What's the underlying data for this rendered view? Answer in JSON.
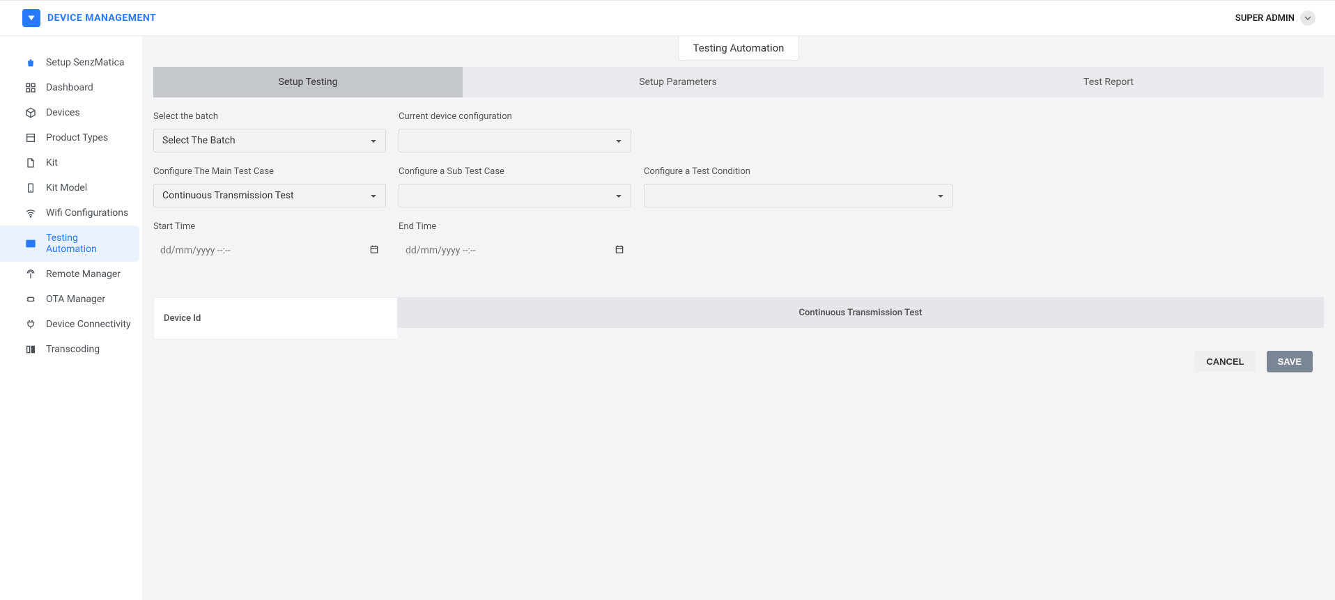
{
  "header": {
    "title": "DEVICE MANAGEMENT",
    "user": "SUPER ADMIN"
  },
  "sidebar": {
    "items": [
      {
        "label": "Setup SenzMatica",
        "icon": "bag-icon"
      },
      {
        "label": "Dashboard",
        "icon": "grid-icon"
      },
      {
        "label": "Devices",
        "icon": "cube-icon"
      },
      {
        "label": "Product Types",
        "icon": "box-icon"
      },
      {
        "label": "Kit",
        "icon": "file-icon"
      },
      {
        "label": "Kit Model",
        "icon": "phone-icon"
      },
      {
        "label": "Wifi Configurations",
        "icon": "wifi-icon"
      },
      {
        "label": "Testing Automation",
        "icon": "terminal-icon",
        "active": true
      },
      {
        "label": "Remote Manager",
        "icon": "antenna-icon"
      },
      {
        "label": "OTA Manager",
        "icon": "chip-icon"
      },
      {
        "label": "Device Connectivity",
        "icon": "plug-icon"
      },
      {
        "label": "Transcoding",
        "icon": "columns-icon"
      }
    ]
  },
  "breadcrumb": "Testing Automation",
  "tabs": [
    {
      "label": "Setup Testing",
      "active": true
    },
    {
      "label": "Setup Parameters"
    },
    {
      "label": "Test Report"
    }
  ],
  "form": {
    "batch": {
      "label": "Select the batch",
      "value": "Select The Batch"
    },
    "device_config": {
      "label": "Current device configuration",
      "value": ""
    },
    "main_test": {
      "label": "Configure The Main Test Case",
      "value": "Continuous Transmission Test"
    },
    "sub_test": {
      "label": "Configure a Sub Test Case",
      "value": ""
    },
    "condition": {
      "label": "Configure a Test Condition",
      "value": ""
    },
    "start_time": {
      "label": "Start Time",
      "placeholder": "dd/mm/yyyy --:--"
    },
    "end_time": {
      "label": "End Time",
      "placeholder": "dd/mm/yyyy --:--"
    }
  },
  "table": {
    "col_device": "Device Id",
    "col_test": "Continuous Transmission Test"
  },
  "buttons": {
    "cancel": "CANCEL",
    "save": "SAVE"
  }
}
